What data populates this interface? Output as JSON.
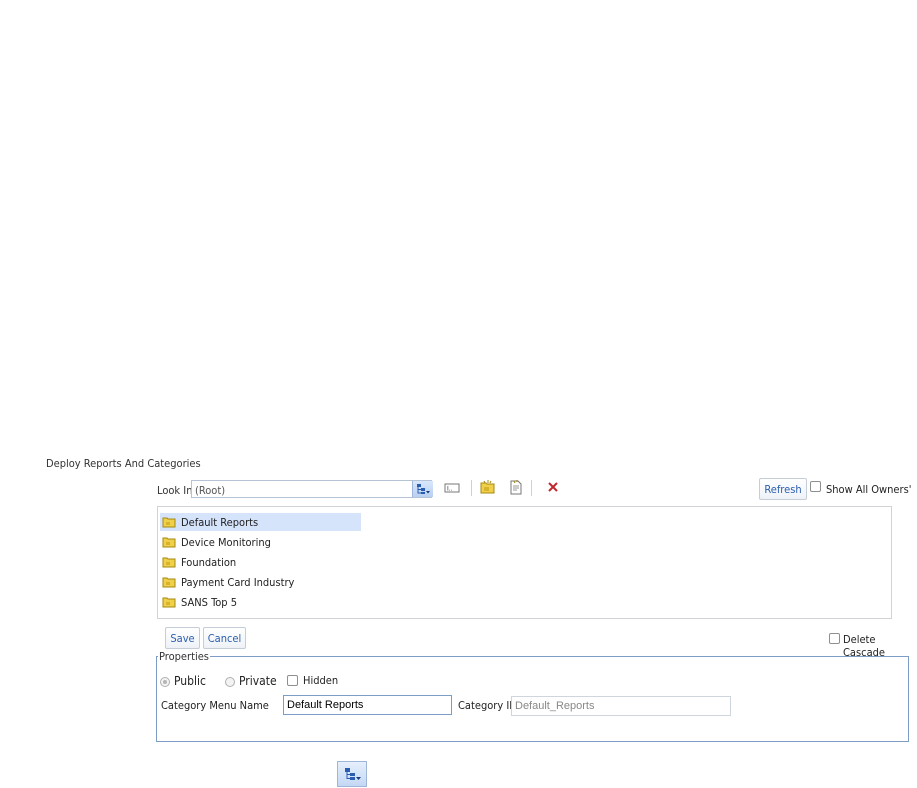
{
  "header": {
    "title": "Deploy Reports And Categories"
  },
  "lookin": {
    "label": "Look In",
    "value": "(Root)"
  },
  "toolbar": {
    "refresh_label": "Refresh",
    "show_all_owners_label": "Show All Owners'",
    "show_all_owners_checked": false
  },
  "tree": {
    "items": [
      {
        "label": "Default Reports",
        "selected": true
      },
      {
        "label": "Device Monitoring",
        "selected": false
      },
      {
        "label": "Foundation",
        "selected": false
      },
      {
        "label": "Payment Card Industry",
        "selected": false
      },
      {
        "label": "SANS Top 5",
        "selected": false
      }
    ]
  },
  "actions": {
    "save_label": "Save",
    "cancel_label": "Cancel",
    "delete_cascade_label": "Delete Cascade",
    "delete_cascade_checked": false
  },
  "properties": {
    "legend": "Properties",
    "public_label": "Public",
    "private_label": "Private",
    "hidden_label": "Hidden",
    "visibility": "Public",
    "hidden_checked": false,
    "category_menu_name_label": "Category Menu Name",
    "category_menu_name_value": "Default Reports",
    "category_id_label": "Category ID",
    "category_id_value": "Default_Reports"
  },
  "colors": {
    "accent": "#2a5db0",
    "selection": "#d5e3fb",
    "border": "#7d9cc6",
    "delete_icon": "#c0282d",
    "folder": "#e8c21f"
  },
  "icons": [
    "tree-dropdown-icon",
    "rename-icon",
    "new-folder-icon",
    "new-report-icon",
    "delete-icon",
    "folder-icon"
  ]
}
